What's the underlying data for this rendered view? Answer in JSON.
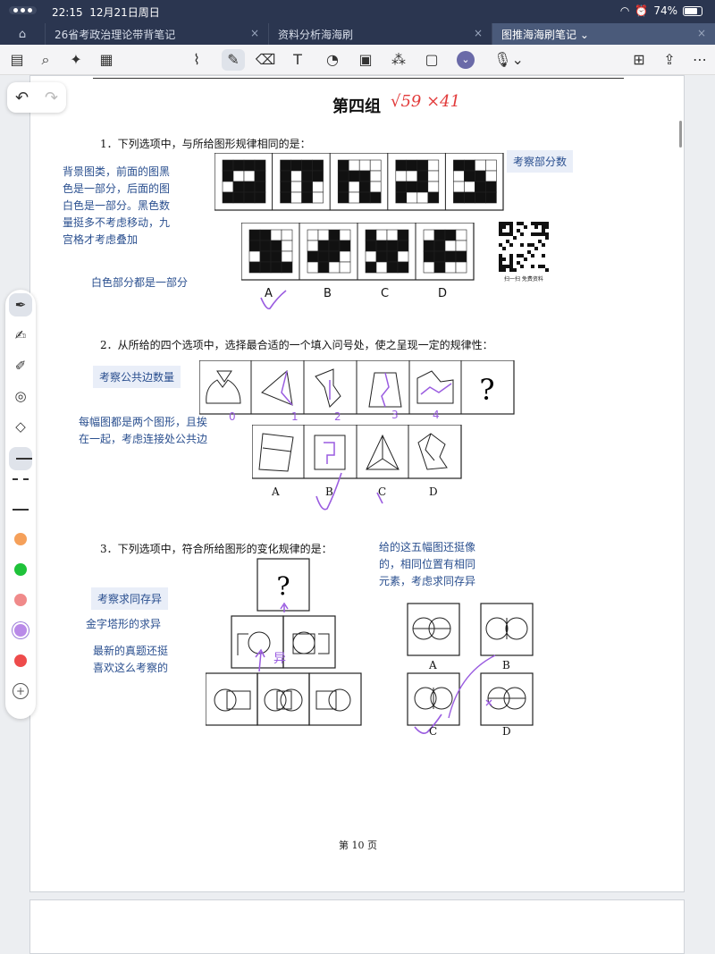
{
  "status": {
    "time": "22:15",
    "date": "12月21日周日",
    "battery": "74%"
  },
  "tabs": [
    {
      "label": "26省考政治理论带背笔记"
    },
    {
      "label": "资料分析海海刷"
    },
    {
      "label": "图推海海刷笔记"
    }
  ],
  "page": {
    "title": "第四组",
    "score": "√59 ×41",
    "q1": {
      "text": "1．下列选项中，与所给图形规律相同的是：",
      "tag": "考察部分数",
      "note": "背景图类，前面的图黑色是一部分，后面的图白色是一部分。黑色数量挺多不考虑移动，九宫格才考虑叠加",
      "note2": "白色部分都是一部分",
      "options": [
        "A",
        "B",
        "C",
        "D"
      ],
      "qr_text": "扫一扫 免费资料"
    },
    "q2": {
      "text": "2．从所给的四个选项中，选择最合适的一个填入问号处，使之呈现一定的规律性：",
      "tag": "考察公共边数量",
      "note": "每幅图都是两个图形，且挨在一起，考虑连接处公共边",
      "question_mark": "?",
      "counts": [
        "0",
        "1",
        "2",
        "3",
        "4"
      ],
      "options": [
        "A",
        "B",
        "C",
        "D"
      ]
    },
    "q3": {
      "text": "3．下列选项中，符合所给图形的变化规律的是：",
      "tag": "考察求同存异",
      "note1": "金字塔形的求异",
      "note2": "最新的真题还挺喜欢这么考察的",
      "note3": "给的这五幅图还挺像的，相同位置有相同元素，考虑求同存异",
      "question_mark": "?",
      "options": [
        "A",
        "B",
        "C",
        "D"
      ],
      "annotation": "异"
    },
    "footer": "第 10 页"
  }
}
